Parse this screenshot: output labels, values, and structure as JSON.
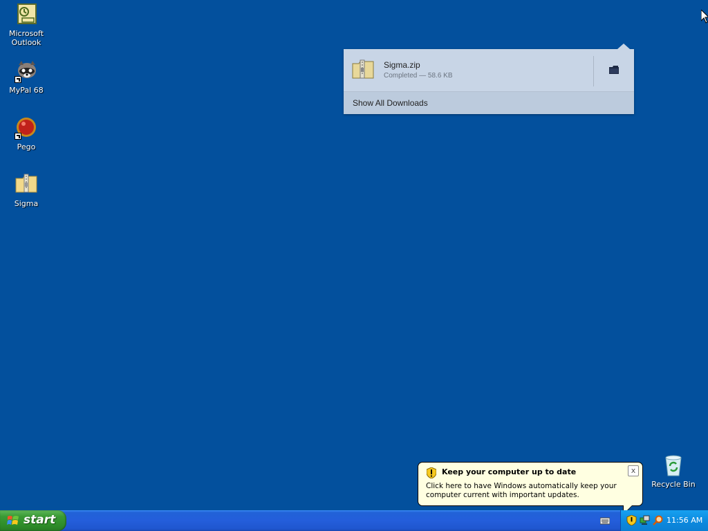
{
  "desktop": {
    "icons": [
      {
        "label": "Microsoft Outlook",
        "icon": "outlook-icon"
      },
      {
        "label": "MyPal 68",
        "icon": "mypal-raccoon-icon"
      },
      {
        "label": "Pego",
        "icon": "pego-red-ball-icon"
      },
      {
        "label": "Sigma",
        "icon": "zip-folder-icon"
      }
    ],
    "recycle_bin": {
      "label": "Recycle Bin",
      "icon": "recycle-bin-icon"
    }
  },
  "downloads_panel": {
    "file_name": "Sigma.zip",
    "status": "Completed — 58.6 KB",
    "file_icon": "zip-folder-icon",
    "open_folder_icon": "folder-icon",
    "show_all_label": "Show All Downloads"
  },
  "balloon": {
    "title": "Keep your computer up to date",
    "body": "Click here to have Windows automatically keep your computer current with important updates.",
    "close_glyph": "x",
    "icon": "shield-icon"
  },
  "taskbar": {
    "start_label": "start",
    "clock": "11:56 AM",
    "tray_icons": [
      "security-shield-icon",
      "network-icon",
      "search-icon"
    ],
    "keyboard_icon": "keyboard-icon"
  },
  "colors": {
    "desktop_bg": "#03509d",
    "taskbar": "#245edb",
    "start_button": "#3a9a35",
    "balloon_bg": "#ffffe1",
    "downloads_panel_bg": "#c8d5e6"
  }
}
